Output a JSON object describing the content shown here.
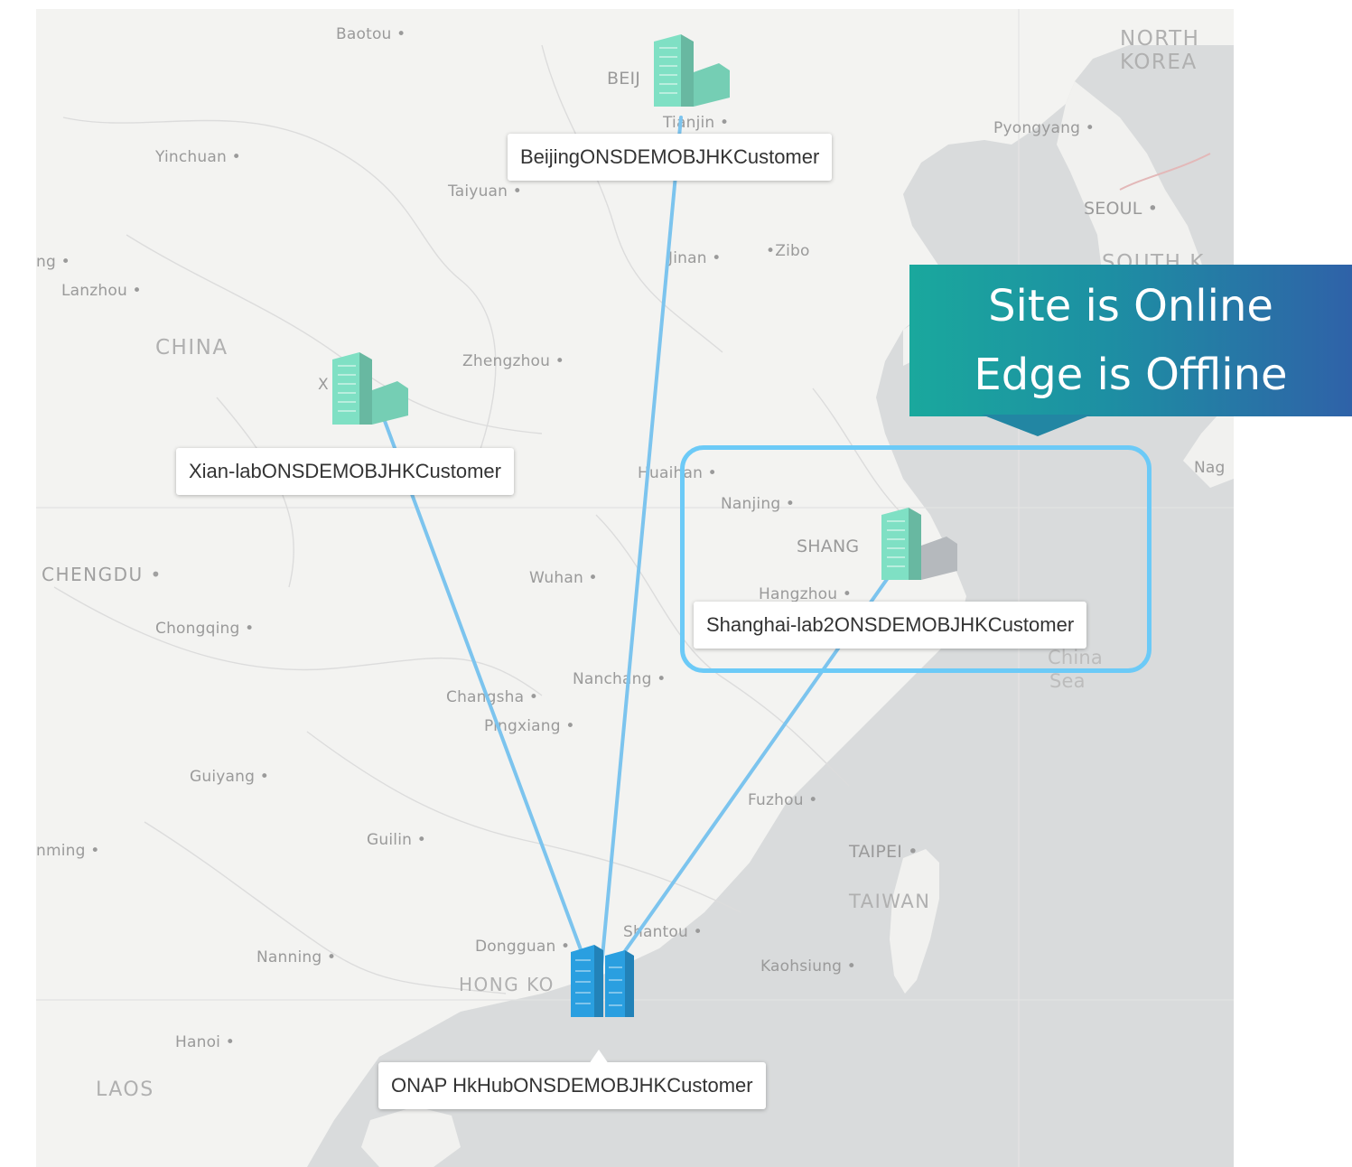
{
  "sites": [
    {
      "id": "beijing",
      "label": "BeijingONSDEMOBJHKCustomer",
      "status_color": "#7fe0c4"
    },
    {
      "id": "xian",
      "label": "Xian-labONSDEMOBJHKCustomer",
      "status_color": "#7fe0c4"
    },
    {
      "id": "shanghai",
      "label": "Shanghai-lab2ONSDEMOBJHKCustomer",
      "status_color": "#7fe0c4",
      "edge_color": "#b5b9bd"
    },
    {
      "id": "hkhub",
      "label": "ONAP HkHubONSDEMOBJHKCustomer",
      "status_color": "#2a9fe0"
    }
  ],
  "link_color": "#7cc4ee",
  "highlight_color": "#6ccaf7",
  "callout": {
    "line1": "Site is Online",
    "line2": "Edge is Offline"
  },
  "places": {
    "baotou": "Baotou",
    "beij": "BEIJ",
    "tianjin": "Tianjin",
    "north_korea_1": "NORTH",
    "north_korea_2": "KOREA",
    "pyongyang": "Pyongyang",
    "yinchuan": "Yinchuan",
    "taiyuan": "Taiyuan",
    "seoul": "SEOUL",
    "jinan": "Jinan",
    "zibo": "Zibo",
    "south_korea": "SOUTH K",
    "ng": "ng",
    "lanzhou": "Lanzhou",
    "china": "CHINA",
    "zhengzhou": "Zhengzhou",
    "xi": "X",
    "huaihan": "Huaihan",
    "nag": "Nag",
    "nanjing": "Nanjing",
    "shanghai": "SHANG",
    "hangzhou": "Hangzhou",
    "chengdu": "CHENGDU",
    "wuhan": "Wuhan",
    "chongqing": "Chongqing",
    "china_sea_1": "China",
    "china_sea_2": "Sea",
    "nanchang": "Nanchang",
    "changsha": "Changsha",
    "pingxiang": "Pingxiang",
    "guiyang": "Guiyang",
    "fuzhou": "Fuzhou",
    "kunming": "nming",
    "guilin": "Guilin",
    "taipei": "TAIPEI",
    "taiwan": "TAIWAN",
    "shantou": "Shantou",
    "dongguan": "Dongguan",
    "nanning": "Nanning",
    "hong_kong": "HONG KO",
    "kaohsiung": "Kaohsiung",
    "hanoi": "Hanoi",
    "laos": "LAOS"
  }
}
